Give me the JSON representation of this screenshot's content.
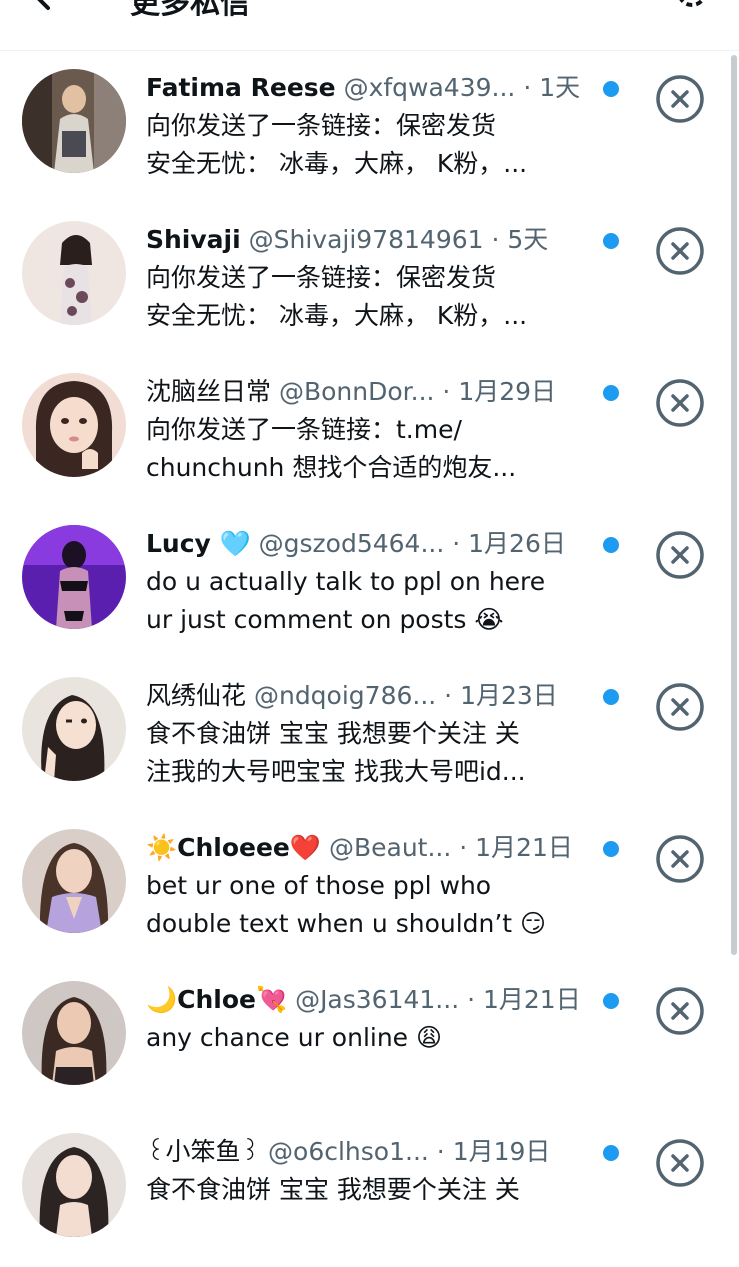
{
  "header": {
    "title": "更多私信",
    "back_icon": "arrow-left-icon",
    "settings_icon": "gear-icon"
  },
  "colors": {
    "accent": "#1d9bf0",
    "text_primary": "#0f1419",
    "text_secondary": "#536471",
    "divider": "#eff3f4",
    "dismiss_icon": "#536471"
  },
  "requests": [
    {
      "name": "Fatima Reese",
      "handle": "@xfqwa439...",
      "separator": " · ",
      "time": "1天",
      "preview_line1": "向你发送了一条链接：保密发货",
      "preview_line2": "安全无忧： 冰毒，大麻， K粉，...",
      "unread": true
    },
    {
      "name": "Shivaji",
      "handle": "@Shivaji97814961",
      "separator": " · ",
      "time": "5天",
      "preview_line1": "向你发送了一条链接：保密发货",
      "preview_line2": "安全无忧： 冰毒，大麻， K粉，...",
      "unread": true
    },
    {
      "name": "沈脑丝日常",
      "handle": "@BonnDor...",
      "separator": " · ",
      "time": "1月29日",
      "preview_line1": "向你发送了一条链接：t.me/",
      "preview_line2": "chunchunh 想找个合适的炮友...",
      "unread": true
    },
    {
      "name": "Lucy 🩵",
      "handle": "@gszod5464...",
      "separator": " · ",
      "time": "1月26日",
      "preview_line1": "do u actually talk to ppl on here",
      "preview_line2": "ur just comment on posts 😭",
      "unread": true
    },
    {
      "name": "风绣仙花",
      "handle": "@ndqoig786...",
      "separator": " · ",
      "time": "1月23日",
      "preview_line1": "食不食油饼 宝宝  我想要个关注 关",
      "preview_line2": "注我的大号吧宝宝 找我大号吧id...",
      "unread": true
    },
    {
      "name": "☀️Chloeee❤️",
      "handle": "@Beaut...",
      "separator": " · ",
      "time": "1月21日",
      "preview_line1": "bet ur one of those ppl who",
      "preview_line2": "double text when u shouldn’t 😏",
      "unread": true
    },
    {
      "name": "🌙Chloe💘",
      "handle": "@Jas36141...",
      "separator": " · ",
      "time": "1月21日",
      "preview_line1": "any chance ur online 😩",
      "preview_line2": "",
      "unread": true
    },
    {
      "name": "꒰小笨鱼꒱",
      "handle": "@o6clhso1...",
      "separator": " · ",
      "time": "1月19日",
      "preview_line1": "食不食油饼 宝宝  我想要个关注 关",
      "preview_line2": "",
      "unread": true
    }
  ],
  "dismiss_icon": "close-circle-icon"
}
